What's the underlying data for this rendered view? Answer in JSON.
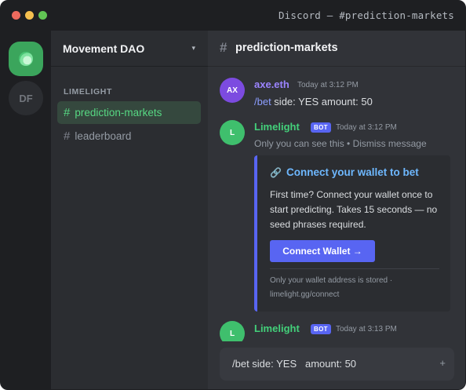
{
  "window": {
    "title": "Discord — #prediction-markets"
  },
  "rail": {
    "servers": [
      {
        "label": "",
        "active": true,
        "icon": "limelight-leaf-icon"
      },
      {
        "label": "DF",
        "active": false
      }
    ]
  },
  "sidebar": {
    "server_name": "Movement DAO",
    "chevron": "▾",
    "category": "LIMELIGHT",
    "channels": [
      {
        "hash": "#",
        "name": "prediction-markets",
        "active": true
      },
      {
        "hash": "#",
        "name": "leaderboard",
        "active": false
      }
    ]
  },
  "chat": {
    "hash": "#",
    "channel_name": "prediction-markets",
    "messages": [
      {
        "avatar": "AX",
        "author": "axe.eth",
        "timestamp": "Today at 3:12 PM",
        "command": "/bet",
        "text": " side: YES amount: 50"
      },
      {
        "avatar": "L",
        "author": "Limelight",
        "badge": "BOT",
        "timestamp": "Today at 3:12 PM",
        "ephemeral": "Only you can see this • Dismiss message",
        "embed": {
          "icon": "🔗",
          "title": "Connect your wallet to bet",
          "description": "First time? Connect your wallet once to start predicting. Takes 15 seconds — no seed phrases required.",
          "button": "Connect Wallet →",
          "footer": "Only your wallet address is stored · limelight.gg/connect"
        }
      },
      {
        "avatar": "L",
        "author": "Limelight",
        "badge": "BOT",
        "timestamp": "Today at 3:13 PM"
      }
    ]
  },
  "composer": {
    "value": "/bet side: YES   amount: 50",
    "plus": "+"
  },
  "colors": {
    "accent": "#5865f2",
    "limelight_green": "#43d07a",
    "purple_user": "#9b84ff",
    "embed_title": "#6eb8ff"
  }
}
